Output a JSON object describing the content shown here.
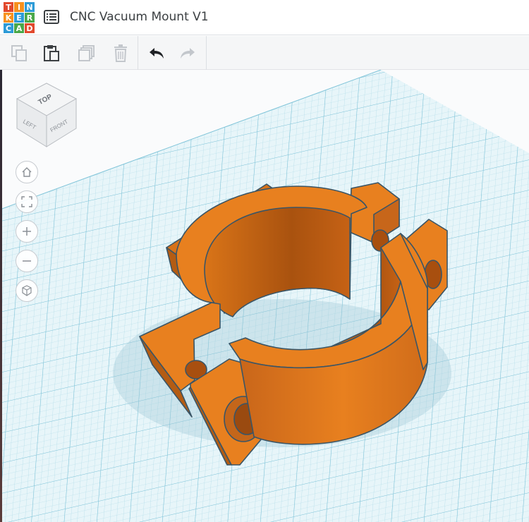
{
  "app": {
    "logo_letters": [
      "T",
      "I",
      "N",
      "K",
      "E",
      "R",
      "C",
      "A",
      "D"
    ],
    "logo_colors": [
      "#e2492d",
      "#f7911e",
      "#2d9bd7",
      "#f7911e",
      "#2d9bd7",
      "#4aa84a",
      "#2d9bd7",
      "#4aa84a",
      "#e2492d"
    ],
    "title": "CNC Vacuum Mount V1"
  },
  "toolbar": {
    "buttons": [
      "copy",
      "paste",
      "duplicate",
      "delete",
      "undo",
      "redo"
    ],
    "enabled": {
      "copy": false,
      "paste": true,
      "duplicate": false,
      "delete": false,
      "undo": true,
      "redo": false
    }
  },
  "viewcube": {
    "top": "TOP",
    "left": "LEFT",
    "front": "FRONT"
  },
  "nav_controls": [
    "home-view",
    "fit-all",
    "zoom-in",
    "zoom-out",
    "ortho-view"
  ],
  "colors": {
    "accent_orange": "#e8801f",
    "grid_line": "#9ed3e2",
    "grid_bg": "#e6f4f8",
    "toolbar_bg": "#f5f6f7"
  }
}
